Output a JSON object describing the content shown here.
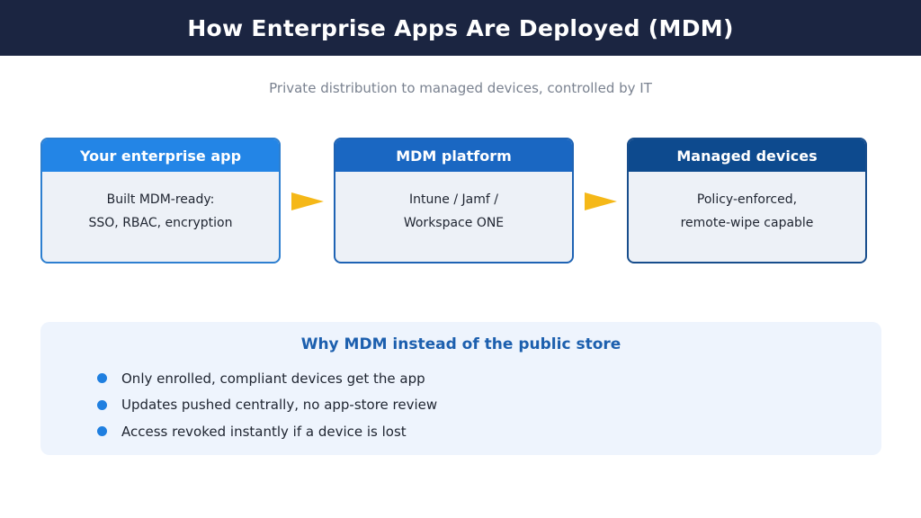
{
  "header": {
    "title": "How Enterprise Apps Are Deployed (MDM)"
  },
  "subtitle": "Private distribution to managed devices, controlled by IT",
  "flow": [
    {
      "title": "Your enterprise app",
      "lines": [
        "Built MDM-ready:",
        "SSO, RBAC, encryption"
      ],
      "head_color": "#2385e6",
      "border_color": "#2d7fd0"
    },
    {
      "title": "MDM platform",
      "lines": [
        "Intune / Jamf /",
        "Workspace ONE"
      ],
      "head_color": "#1a67c2",
      "border_color": "#1e63b4"
    },
    {
      "title": "Managed devices",
      "lines": [
        "Policy-enforced,",
        "remote-wipe capable"
      ],
      "head_color": "#0d4a8e",
      "border_color": "#174d8c"
    }
  ],
  "arrow_color": "#f5b818",
  "why": {
    "title": "Why MDM instead of the public store",
    "items": [
      "Only enrolled, compliant devices get the app",
      "Updates pushed centrally, no app-store review",
      "Access revoked instantly if a device is lost"
    ],
    "bullet_color": "#1f7fe0"
  }
}
